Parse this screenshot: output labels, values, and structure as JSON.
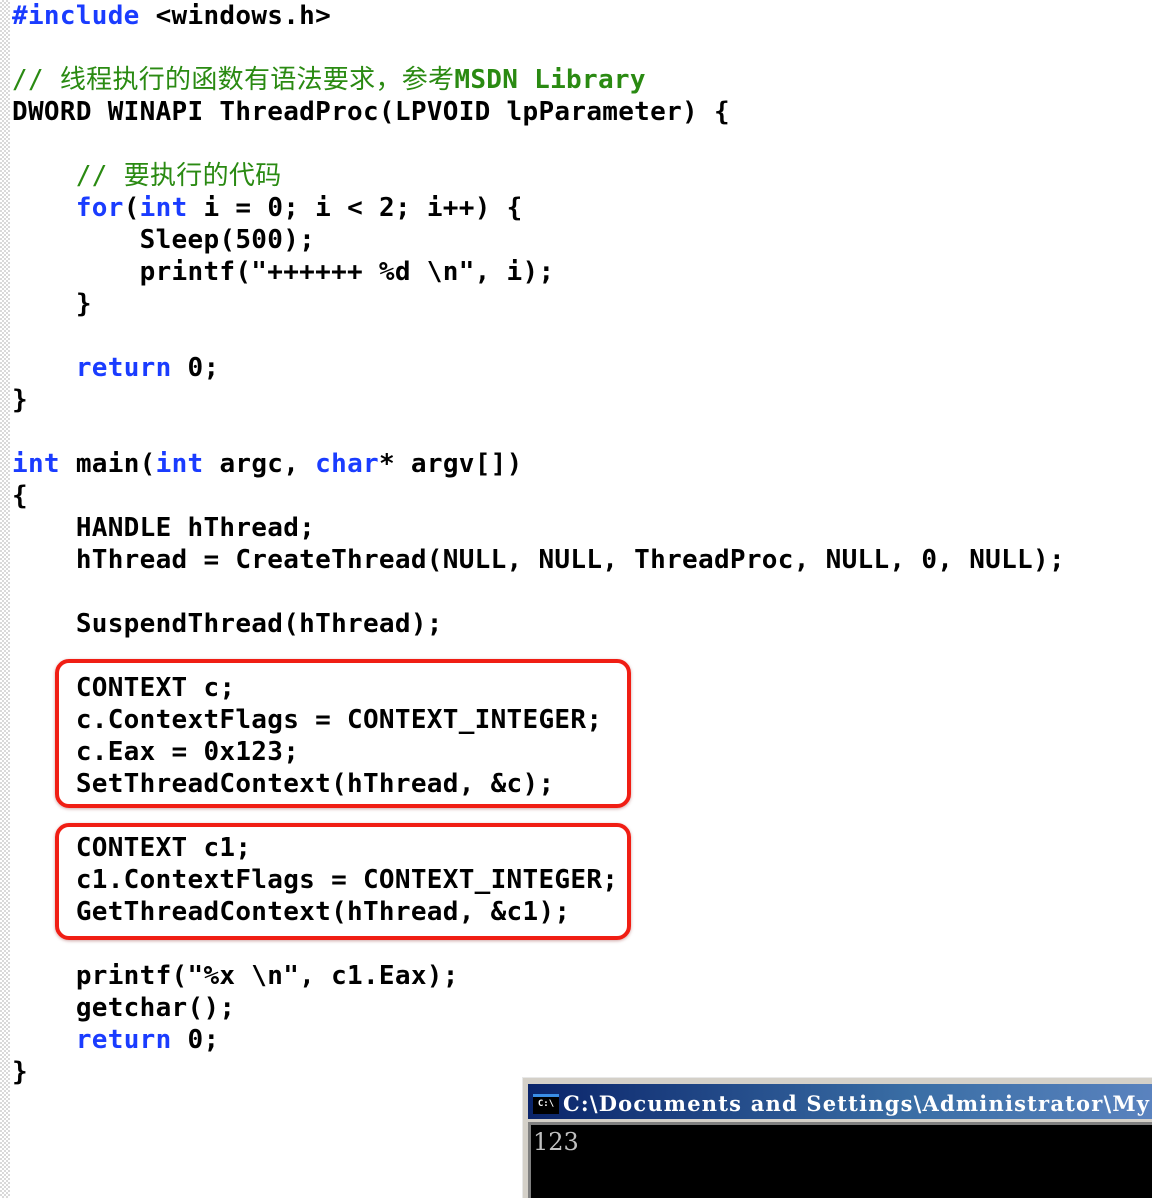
{
  "editor": {
    "lines": [
      [
        {
          "t": "#include",
          "c": "kw"
        },
        {
          "t": " <windows.h>",
          "c": ""
        }
      ],
      [],
      [
        {
          "t": "// 线程执行的函数有语法要求，参考",
          "c": "cm"
        },
        {
          "t": "MSDN Library",
          "c": "cmb"
        }
      ],
      [
        {
          "t": "DWORD WINAPI ThreadProc(LPVOID lpParameter) {",
          "c": ""
        }
      ],
      [],
      [
        {
          "t": "    ",
          "c": ""
        },
        {
          "t": "// 要执行的代码",
          "c": "cm"
        }
      ],
      [
        {
          "t": "    ",
          "c": ""
        },
        {
          "t": "for",
          "c": "kw"
        },
        {
          "t": "(",
          "c": ""
        },
        {
          "t": "int",
          "c": "kw"
        },
        {
          "t": " i = 0; i < 2; i++) {",
          "c": ""
        }
      ],
      [
        {
          "t": "        Sleep(500);",
          "c": ""
        }
      ],
      [
        {
          "t": "        printf(\"++++++ %d \\n\", i);",
          "c": ""
        }
      ],
      [
        {
          "t": "    }",
          "c": ""
        }
      ],
      [],
      [
        {
          "t": "    ",
          "c": ""
        },
        {
          "t": "return",
          "c": "kw"
        },
        {
          "t": " 0;",
          "c": ""
        }
      ],
      [
        {
          "t": "}",
          "c": ""
        }
      ],
      [],
      [
        {
          "t": "int",
          "c": "kw"
        },
        {
          "t": " main(",
          "c": ""
        },
        {
          "t": "int",
          "c": "kw"
        },
        {
          "t": " argc, ",
          "c": ""
        },
        {
          "t": "char",
          "c": "kw"
        },
        {
          "t": "* argv[])",
          "c": ""
        }
      ],
      [
        {
          "t": "{",
          "c": ""
        }
      ],
      [
        {
          "t": "    HANDLE hThread;",
          "c": ""
        }
      ],
      [
        {
          "t": "    hThread = CreateThread(NULL, NULL, ThreadProc, NULL, 0, NULL);",
          "c": ""
        }
      ],
      [],
      [
        {
          "t": "    SuspendThread(hThread);",
          "c": ""
        }
      ],
      [],
      [
        {
          "t": "    CONTEXT c;",
          "c": ""
        }
      ],
      [
        {
          "t": "    c.ContextFlags = CONTEXT_INTEGER;",
          "c": ""
        }
      ],
      [
        {
          "t": "    c.Eax = 0x123;",
          "c": ""
        }
      ],
      [
        {
          "t": "    SetThreadContext(hThread, &c);",
          "c": ""
        }
      ],
      [],
      [
        {
          "t": "    CONTEXT c1;",
          "c": ""
        }
      ],
      [
        {
          "t": "    c1.ContextFlags = CONTEXT_INTEGER;",
          "c": ""
        }
      ],
      [
        {
          "t": "    GetThreadContext(hThread, &c1);",
          "c": ""
        }
      ],
      [],
      [
        {
          "t": "    printf(\"%x \\n\", c1.Eax);",
          "c": ""
        }
      ],
      [
        {
          "t": "    getchar();",
          "c": ""
        }
      ],
      [
        {
          "t": "    ",
          "c": ""
        },
        {
          "t": "return",
          "c": "kw"
        },
        {
          "t": " 0;",
          "c": ""
        }
      ],
      [
        {
          "t": "}",
          "c": ""
        }
      ]
    ]
  },
  "highlights": [
    {
      "name": "set-thread-context-block",
      "color": "#f01e14"
    },
    {
      "name": "get-thread-context-block",
      "color": "#f01e14"
    }
  ],
  "console": {
    "icon_label": "C:\\",
    "title": "C:\\Documents and Settings\\Administrator\\My",
    "output": "123"
  },
  "colors": {
    "keyword": "#1a3cff",
    "comment": "#2a8a12",
    "text": "#000000",
    "highlight": "#f01e14",
    "console_title_start": "#0a246a",
    "console_title_end": "#5c84c0",
    "console_bg": "#000000",
    "console_text": "#c0c0c0"
  }
}
